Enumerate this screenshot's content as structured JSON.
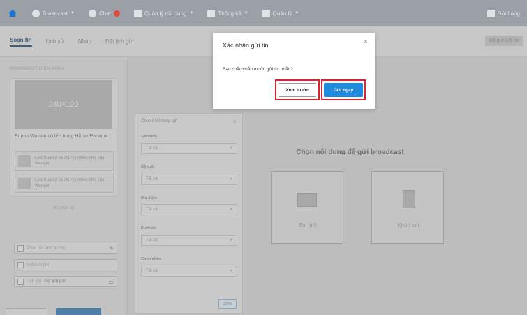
{
  "topbar": {
    "items": [
      {
        "label": "Broadcast"
      },
      {
        "label": "Chat"
      },
      {
        "label": "Quản lý nội dung"
      },
      {
        "label": "Thống kê"
      },
      {
        "label": "Quản lý"
      }
    ],
    "right_label": "Gói hàng"
  },
  "subbar": {
    "tabs": [
      {
        "label": "Soạn tin"
      },
      {
        "label": "Lịch sử"
      },
      {
        "label": "Nháp"
      },
      {
        "label": "Đặt lịch gửi"
      }
    ],
    "sent_count": "Đã gửi 1/5 tin"
  },
  "left_panel": {
    "heading": "BROADCAST HIỆN HÀNH",
    "thumb_text": "240×120",
    "card_title": "Emma Watson có tên trong Hồ sơ Panama",
    "sub_items": [
      {
        "text": "Luis Suarez và chữ ký nhiều như của Wenger"
      },
      {
        "text": "Luis Suarez và chữ ký nhiều như của Wenger"
      }
    ],
    "more": "Bỏ chọn tin",
    "field1": "Chọn nút tương ứng",
    "field2": "Đặt cụm tên",
    "field3_prefix": "Lịch gửi",
    "field3_value": "Đặt lịch gửi"
  },
  "audience": {
    "heading": "Chọn đối tượng gửi",
    "fields": [
      {
        "label": "Giới tính",
        "value": "Tất cả"
      },
      {
        "label": "Độ tuổi",
        "value": "Tất cả"
      },
      {
        "label": "Địa điểm",
        "value": "Tất cả"
      },
      {
        "label": "Platform",
        "value": "Tất cả"
      },
      {
        "label": "Chọn nhãn",
        "value": "Tất cả"
      }
    ],
    "apply": "Xong"
  },
  "content": {
    "title": "Chọn nội dung để gửi broadcast",
    "tiles": [
      {
        "label": "Bài viết"
      },
      {
        "label": "Khảo sát"
      }
    ]
  },
  "modal": {
    "title": "Xác nhận gửi tin",
    "close": "×",
    "body": "Bạn chắc chắn muốn gửi tin nhắn?",
    "preview_label": "Xem trước",
    "send_label": "Gửi ngay"
  },
  "colors": {
    "primary": "#1f8be0",
    "highlight": "#d8252f",
    "home_icon": "#1e6fd0",
    "chat_badge": "#e04a3a"
  }
}
